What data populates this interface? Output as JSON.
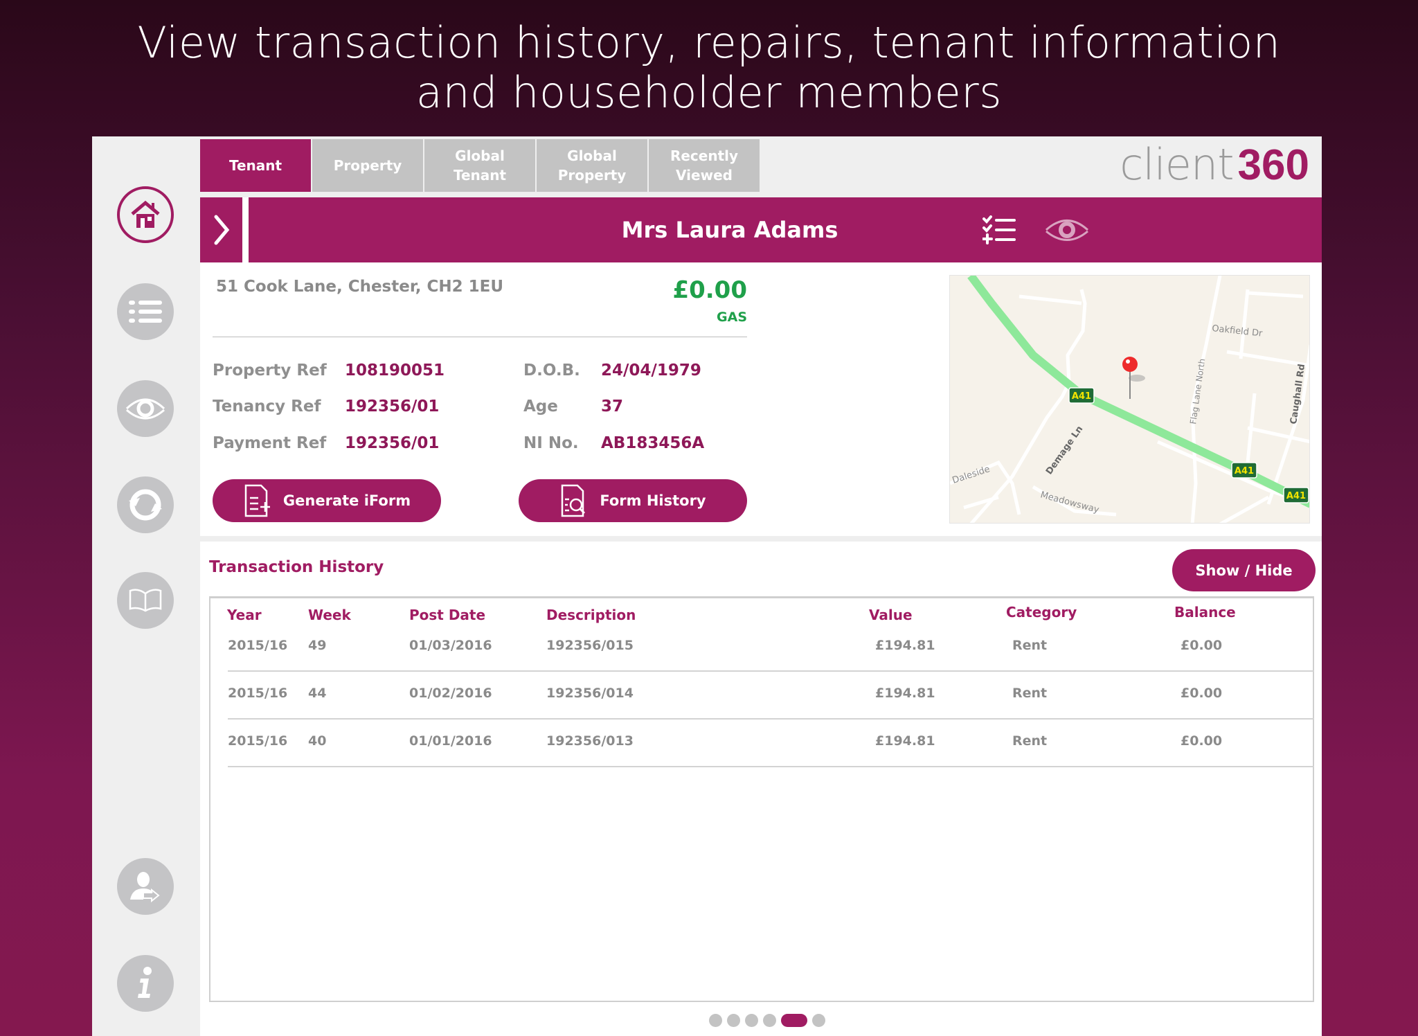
{
  "headline": {
    "line1": "View transaction history, repairs, tenant information",
    "line2": "and householder members"
  },
  "logo": {
    "client": "client",
    "number": "360"
  },
  "tabs": [
    {
      "label": "Tenant",
      "active": true
    },
    {
      "label": "Property",
      "active": false
    },
    {
      "label": "Global Tenant",
      "active": false
    },
    {
      "label": "Global Property",
      "active": false
    },
    {
      "label": "Recently Viewed",
      "active": false
    }
  ],
  "sidebar": {
    "items": [
      "home-icon",
      "list-icon",
      "eye-icon",
      "sync-icon",
      "book-icon",
      "user-transfer-icon",
      "info-icon"
    ],
    "active": "home-icon"
  },
  "header": {
    "name": "Mrs Laura Adams",
    "icons": [
      "checklist-icon",
      "eye-icon"
    ]
  },
  "tenant": {
    "address": "51 Cook Lane, Chester, CH2 1EU",
    "balance": "£0.00",
    "balance_label": "GAS",
    "fields_left": [
      {
        "label": "Property Ref",
        "value": "108190051"
      },
      {
        "label": "Tenancy Ref",
        "value": "192356/01"
      },
      {
        "label": "Payment Ref",
        "value": "192356/01"
      }
    ],
    "fields_right": [
      {
        "label": "D.O.B.",
        "value": "24/04/1979"
      },
      {
        "label": "Age",
        "value": "37"
      },
      {
        "label": "NI No.",
        "value": "AB183456A"
      }
    ],
    "generate_label": "Generate iForm",
    "history_label": "Form History"
  },
  "map": {
    "labels": {
      "road": "A41",
      "oakfield": "Oakfield Dr",
      "flag": "Flag Lane North",
      "caughall": "Caughall Rd",
      "demage": "Demage Ln",
      "daleside": "Daleside",
      "meadows": "Meadowsway"
    }
  },
  "transactions": {
    "title": "Transaction History",
    "toggle_label": "Show / Hide",
    "columns": [
      "Year",
      "Week",
      "Post Date",
      "Description",
      "Value",
      "Category",
      "Balance"
    ],
    "rows": [
      [
        "2015/16",
        "49",
        "01/03/2016",
        "192356/015",
        "£194.81",
        "Rent",
        "£0.00"
      ],
      [
        "2015/16",
        "44",
        "01/02/2016",
        "192356/014",
        "£194.81",
        "Rent",
        "£0.00"
      ],
      [
        "2015/16",
        "40",
        "01/01/2016",
        "192356/013",
        "£194.81",
        "Rent",
        "£0.00"
      ]
    ]
  },
  "pagination": {
    "pages": 6,
    "current": 5
  },
  "colors": {
    "brand": "#a01c62",
    "positive": "#1fa04a",
    "road": "#8ee89a"
  }
}
